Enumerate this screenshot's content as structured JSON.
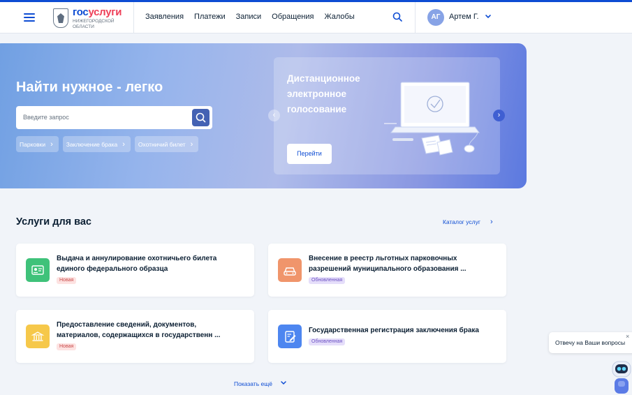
{
  "header": {
    "logo_main_part1": "гос",
    "logo_main_part2": "услуги",
    "logo_sub": "Нижегородской области",
    "nav": [
      "Заявления",
      "Платежи",
      "Записи",
      "Обращения",
      "Жалобы"
    ],
    "avatar_initials": "АГ",
    "user_name": "Артем Г."
  },
  "hero": {
    "title": "Найти нужное - легко",
    "search_placeholder": "Введите запрос",
    "chips": [
      "Парковки",
      "Заключение брака",
      "Охотничий билет"
    ],
    "promo_title": "Дистанционное электронное голосование",
    "promo_button": "Перейти"
  },
  "services": {
    "title": "Услуги для вас",
    "catalog_link": "Каталог услуг",
    "cards": [
      {
        "title": "Выдача и аннулирование охотничьего билета единого федерального образца",
        "badge": "Новая",
        "badge_type": "new",
        "icon": "id-card-icon",
        "icon_color": "#3fc27a"
      },
      {
        "title": "Внесение в реестр льготных парковочных разрешений муниципального образования ...",
        "badge": "Обновленная",
        "badge_type": "updated",
        "icon": "car-icon",
        "icon_color": "#f0956b"
      },
      {
        "title": "Предоставление сведений, документов, материалов, содержащихся в государственн ...",
        "badge": "Новая",
        "badge_type": "new",
        "icon": "building-icon",
        "icon_color": "#f6c84a"
      },
      {
        "title": "Государственная регистрация заключения брака",
        "badge": "Обновленная",
        "badge_type": "updated",
        "icon": "document-edit-icon",
        "icon_color": "#4d86f0"
      }
    ],
    "show_more": "Показать ещё"
  },
  "chat": {
    "bubble_text": "Отвечу на Ваши вопросы",
    "close": "×"
  },
  "colors": {
    "primary": "#0d4cd3",
    "brand_red": "#ee3f58",
    "background": "#f1f4f9"
  }
}
